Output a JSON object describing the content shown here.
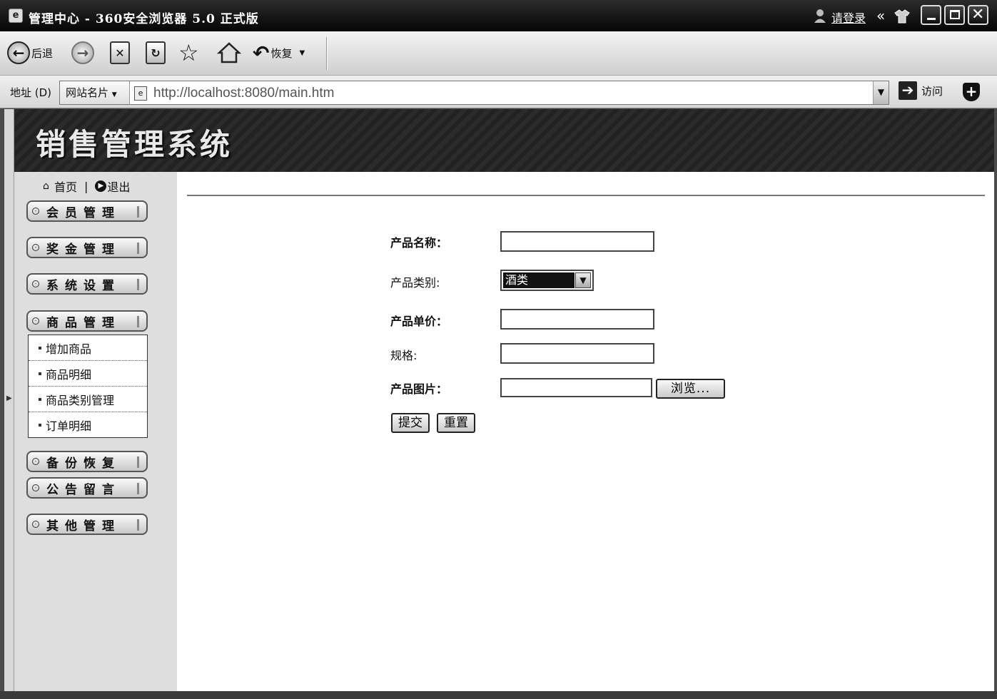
{
  "window": {
    "title": "管理中心 - 360安全浏览器 5.0 正式版",
    "login_link": "请登录",
    "collapse_glyph": "«"
  },
  "toolbar": {
    "back_label": "后退",
    "restore_label": "恢复"
  },
  "addressbar": {
    "label": "地址 (D)",
    "site_name": "网站名片",
    "url": "http://localhost:8080/main.htm",
    "go_label": "访问"
  },
  "banner": {
    "title": "销售管理系统"
  },
  "sidebar": {
    "home_label": "首页",
    "separator": "|",
    "exit_label": "退出",
    "menus": [
      {
        "label": "会员管理"
      },
      {
        "label": "奖金管理"
      },
      {
        "label": "系统设置"
      },
      {
        "label": "商品管理"
      },
      {
        "label": "备份恢复"
      },
      {
        "label": "公告留言"
      },
      {
        "label": "其他管理"
      }
    ],
    "submenu": [
      {
        "label": "增加商品"
      },
      {
        "label": "商品明细"
      },
      {
        "label": "商品类别管理"
      },
      {
        "label": "订单明细"
      }
    ]
  },
  "form": {
    "name_label": "产品名称：",
    "name_value": "",
    "category_label": "产品类别:",
    "category_value": "酒类",
    "price_label": "产品单价：",
    "price_value": "",
    "spec_label": "规格:",
    "spec_value": "",
    "image_label": "产品图片：",
    "image_value": "",
    "browse_label": "浏览...",
    "submit_label": "提交",
    "reset_label": "重置"
  }
}
